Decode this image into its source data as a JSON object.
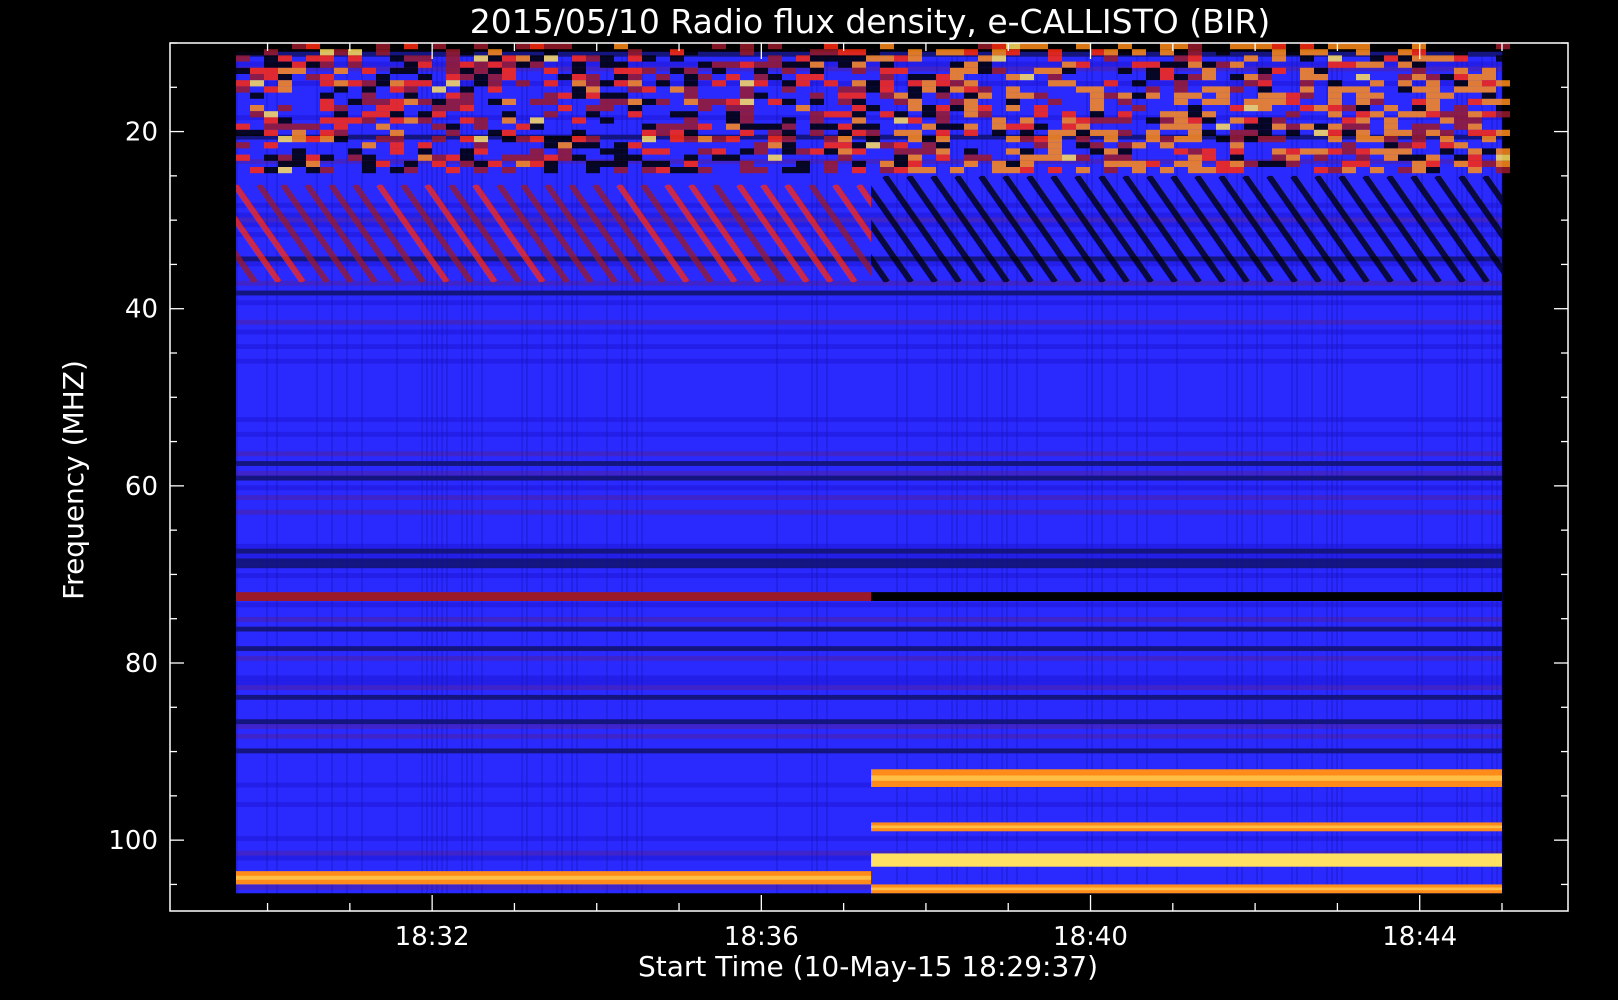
{
  "chart_data": {
    "type": "heatmap",
    "title": "2015/05/10  Radio flux density, e-CALLISTO (BIR)",
    "xlabel": "Start Time (10-May-15 18:29:37)",
    "ylabel": "Frequency (MHZ)",
    "x_range": [
      "18:29:37",
      "18:45:00"
    ],
    "x_ticks": [
      "18:32",
      "18:36",
      "18:40",
      "18:44"
    ],
    "y_range": [
      10,
      108
    ],
    "y_inverted": true,
    "y_ticks": [
      20,
      40,
      60,
      80,
      100
    ],
    "colormap": [
      "#000000",
      "#1a10cc",
      "#2a2aff",
      "#9a1a2a",
      "#ff2a10",
      "#ff8c1a",
      "#ffe060"
    ],
    "colors": {
      "axis": "#ffffff",
      "background": "#000000",
      "base_signal": "#2a2aff"
    },
    "segments": [
      {
        "start": "18:29:37",
        "end": "18:37:20"
      },
      {
        "start": "18:37:20",
        "end": "18:45:00"
      }
    ],
    "bands": [
      {
        "f_low": 10,
        "f_high": 24,
        "intensity": 0.75,
        "segment": "both"
      },
      {
        "f_low": 26,
        "f_high": 37,
        "intensity": 0.55,
        "segment": "first",
        "pattern": "diagonal-stripes"
      },
      {
        "f_low": 25,
        "f_high": 37,
        "intensity": 0.15,
        "segment": "second",
        "pattern": "diagonal-stripes"
      },
      {
        "f_low": 72,
        "f_high": 73,
        "intensity": 0.45,
        "segment": "first"
      },
      {
        "f_low": 72,
        "f_high": 73,
        "intensity": 0.05,
        "segment": "second"
      },
      {
        "f_low": 92,
        "f_high": 94,
        "intensity": 0.85,
        "segment": "second"
      },
      {
        "f_low": 98,
        "f_high": 99,
        "intensity": 0.9,
        "segment": "second"
      },
      {
        "f_low": 101.5,
        "f_high": 103,
        "intensity": 0.95,
        "segment": "second"
      },
      {
        "f_low": 103.5,
        "f_high": 105,
        "intensity": 0.85,
        "segment": "first"
      },
      {
        "f_low": 105,
        "f_high": 106,
        "intensity": 0.8,
        "segment": "second"
      }
    ]
  }
}
